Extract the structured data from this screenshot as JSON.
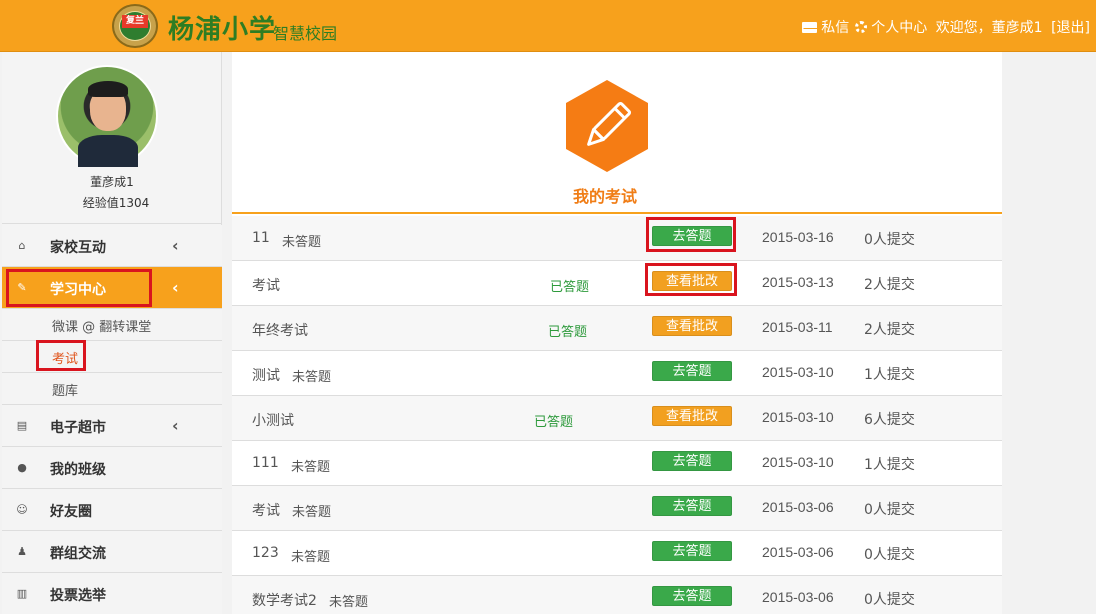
{
  "header": {
    "badge_text": "复兰",
    "school_name": "杨浦小学",
    "school_sub": "智慧校园",
    "message_label": "私信",
    "center_label": "个人中心",
    "welcome": "欢迎您，董彦成1",
    "logout": "[退出]",
    "bg_color": "#f7a11c"
  },
  "profile": {
    "name": "董彦成1",
    "exp": "经验值1304"
  },
  "nav": {
    "home": {
      "label": "家校互动",
      "chev": "‹",
      "icon": "home-icon"
    },
    "study": {
      "label": "学习中心",
      "chev": "‹",
      "icon": "edit-icon"
    },
    "sub1": "微课 @ 翻转课堂",
    "sub2": "考试",
    "sub3": "题库",
    "market": {
      "label": "电子超市",
      "chev": "‹",
      "icon": "cart-icon"
    },
    "class": {
      "label": "我的班级",
      "icon": "user-icon"
    },
    "friends": {
      "label": "好友圈",
      "icon": "smile-icon"
    },
    "group": {
      "label": "群组交流",
      "icon": "group-icon"
    },
    "vote": {
      "label": "投票选举",
      "icon": "chart-icon"
    }
  },
  "main": {
    "title": "我的考试",
    "accent": "#f07d16",
    "exams": [
      {
        "name": "11",
        "status": "未答题",
        "action": "去答题",
        "date": "2015-03-16",
        "count": "0人提交"
      },
      {
        "name": "考试",
        "status": "已答题",
        "action": "查看批改",
        "date": "2015-03-13",
        "count": "2人提交"
      },
      {
        "name": "年终考试",
        "status": "已答题",
        "action": "查看批改",
        "date": "2015-03-11",
        "count": "2人提交"
      },
      {
        "name": "测试",
        "status": "未答题",
        "action": "去答题",
        "date": "2015-03-10",
        "count": "1人提交"
      },
      {
        "name": "小测试",
        "status": "已答题",
        "action": "查看批改",
        "date": "2015-03-10",
        "count": "6人提交"
      },
      {
        "name": "111",
        "status": "未答题",
        "action": "去答题",
        "date": "2015-03-10",
        "count": "1人提交"
      },
      {
        "name": "考试",
        "status": "未答题",
        "action": "去答题",
        "date": "2015-03-06",
        "count": "0人提交"
      },
      {
        "name": "123",
        "status": "未答题",
        "action": "去答题",
        "date": "2015-03-06",
        "count": "0人提交"
      },
      {
        "name": "数学考试2",
        "status": "未答题",
        "action": "去答题",
        "date": "2015-03-06",
        "count": "0人提交"
      }
    ]
  }
}
